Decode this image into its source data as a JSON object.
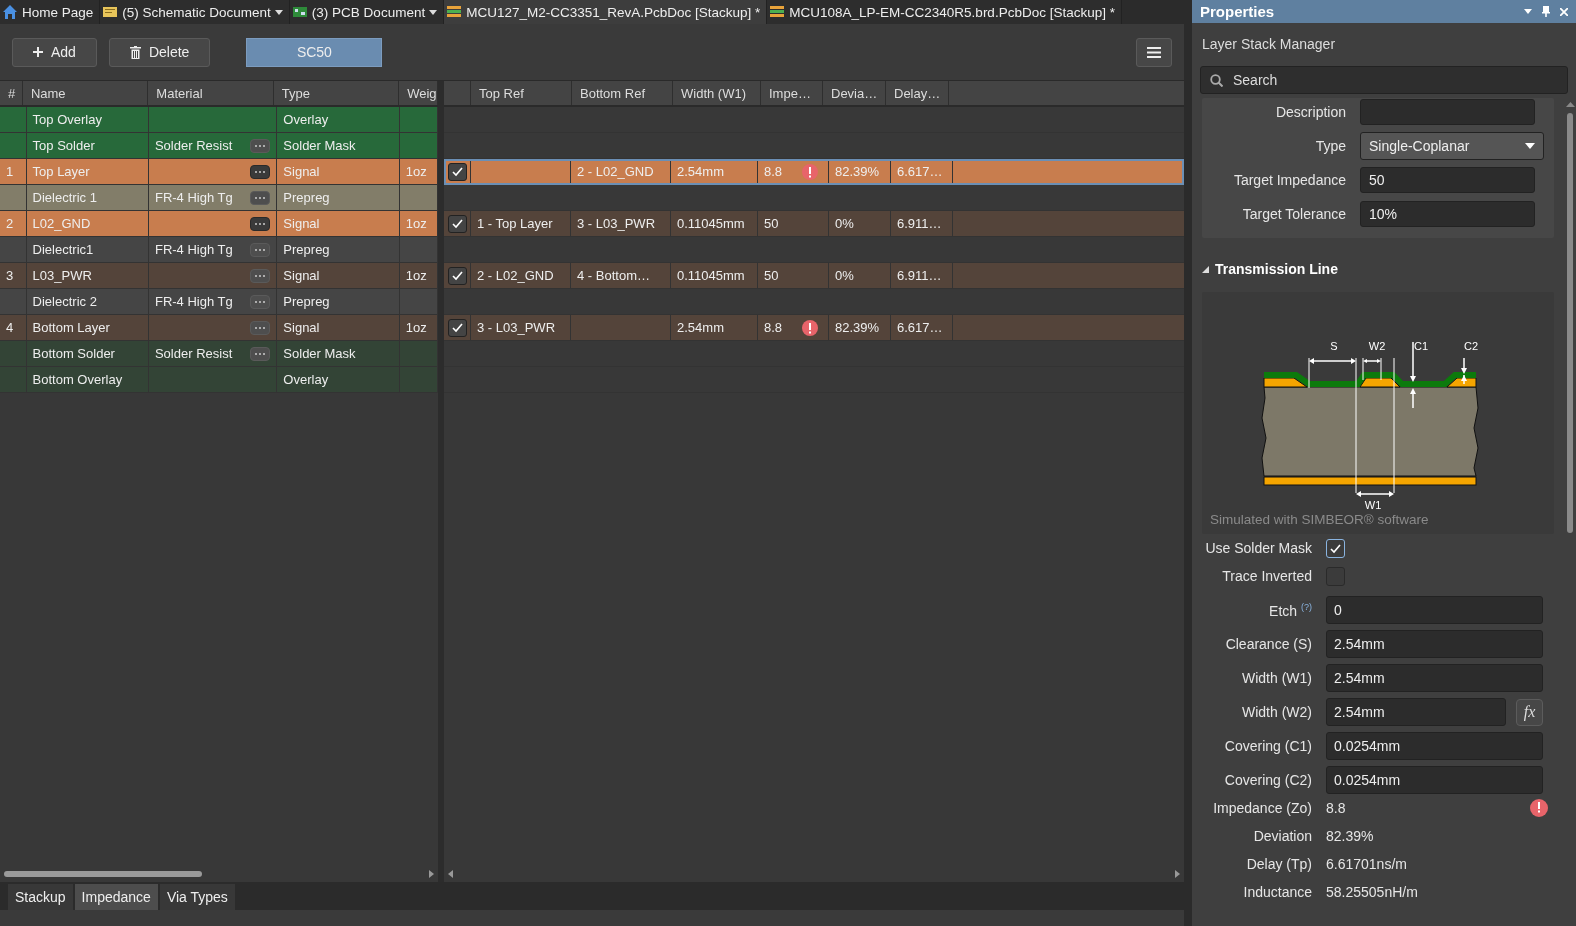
{
  "doc_tabs": [
    {
      "label": "Home Page",
      "kind": "home",
      "selected": false,
      "has_menu": false
    },
    {
      "label": "(5) Schematic Document",
      "kind": "schematic",
      "selected": false,
      "has_menu": true
    },
    {
      "label": "(3) PCB Document",
      "kind": "pcb",
      "selected": false,
      "has_menu": true
    },
    {
      "label": "MCU127_M2-CC3351_RevA.PcbDoc [Stackup] *",
      "kind": "stackup",
      "selected": true,
      "has_menu": false
    },
    {
      "label": "MCU108A_LP-EM-CC2340R5.brd.PcbDoc [Stackup] *",
      "kind": "stackup",
      "selected": false,
      "has_menu": false
    }
  ],
  "toolbar": {
    "buttons": [
      {
        "label": "Add",
        "kind": "add"
      },
      {
        "label": "Delete",
        "kind": "delete"
      }
    ],
    "profiles": [
      {
        "label": "SC50",
        "selected": true
      }
    ]
  },
  "layers": {
    "columns": [
      "#",
      "Name",
      "Material",
      "Type",
      "Weig"
    ],
    "rows": [
      {
        "name": "Top Overlay",
        "type": "Overlay",
        "color": "#27693a",
        "material_button": false
      },
      {
        "name": "Top Solder",
        "material": "Solder Resist",
        "type": "Solder Mask",
        "color": "#27693a",
        "material_button": true
      },
      {
        "number": "1",
        "name": "Top Layer",
        "type": "Signal",
        "weight": "1oz",
        "color": "#c87d4e",
        "material_button": true
      },
      {
        "name": "Dielectric 1",
        "material": "FR-4 High Tg",
        "type": "Prepreg",
        "color": "#827d69",
        "material_button": true
      },
      {
        "number": "2",
        "name": "L02_GND",
        "type": "Signal",
        "weight": "1oz",
        "color": "#c87d4e",
        "material_button": true
      },
      {
        "name": "Dielectric1",
        "material": "FR-4 High Tg",
        "type": "Prepreg",
        "color": "#454545",
        "material_button": true
      },
      {
        "number": "3",
        "name": "L03_PWR",
        "type": "Signal",
        "weight": "1oz",
        "color": "#54443a",
        "material_button": true
      },
      {
        "name": "Dielectric 2",
        "material": "FR-4 High Tg",
        "type": "Prepreg",
        "color": "#454545",
        "material_button": true
      },
      {
        "number": "4",
        "name": "Bottom Layer",
        "type": "Signal",
        "weight": "1oz",
        "color": "#54443a",
        "material_button": true
      },
      {
        "name": "Bottom Solder",
        "material": "Solder Resist",
        "type": "Solder Mask",
        "color": "#334436",
        "material_button": true
      },
      {
        "name": "Bottom Overlay",
        "type": "Overlay",
        "color": "#334436",
        "material_button": false
      }
    ]
  },
  "impedance": {
    "columns": [
      "Top Ref",
      "Bottom Ref",
      "Width (W1)",
      "Impe…",
      "Devia…",
      "Delay…"
    ],
    "rows": [
      {
        "checked": true,
        "selected": true,
        "bottom_ref": "2 - L02_GND",
        "width": "2.54mm",
        "impedance": "8.8",
        "warning": true,
        "deviation": "82.39%",
        "delay": "6.617…"
      },
      {
        "checked": true,
        "selected": false,
        "top_ref": "1 - Top Layer",
        "bottom_ref": "3 - L03_PWR",
        "width": "0.11045mm",
        "impedance": "50",
        "warning": false,
        "deviation": "0%",
        "delay": "6.911…"
      },
      {
        "checked": true,
        "selected": false,
        "top_ref": "2 - L02_GND",
        "bottom_ref": "4 - Bottom…",
        "width": "0.11045mm",
        "impedance": "50",
        "warning": false,
        "deviation": "0%",
        "delay": "6.911…"
      },
      {
        "checked": true,
        "selected": false,
        "top_ref": "3 - L03_PWR",
        "width": "2.54mm",
        "impedance": "8.8",
        "warning": true,
        "deviation": "82.39%",
        "delay": "6.617…"
      }
    ]
  },
  "bottom_tabs": [
    {
      "label": "Stackup",
      "selected": false
    },
    {
      "label": "Impedance",
      "selected": true
    },
    {
      "label": "Via Types",
      "selected": false
    }
  ],
  "panel": {
    "title": "Properties",
    "subtitle": "Layer Stack Manager",
    "search_placeholder": "Search",
    "profile_fields": [
      {
        "label": "Description",
        "kind": "text"
      },
      {
        "label": "Type",
        "kind": "dropdown",
        "value": "Single-Coplanar"
      },
      {
        "label": "Target Impedance",
        "kind": "text",
        "value": "50"
      },
      {
        "label": "Target Tolerance",
        "kind": "text",
        "value": "10%"
      }
    ],
    "section": {
      "title": "Transmission Line",
      "expanded": true,
      "caption": "Simulated with SIMBEOR® software",
      "labels": [
        "S",
        "W2",
        "C1",
        "C2",
        "W1"
      ]
    },
    "options": [
      {
        "label": "Use Solder Mask",
        "kind": "checkbox",
        "checked": true
      },
      {
        "label": "Trace Inverted",
        "kind": "checkbox",
        "checked": false
      },
      {
        "label": "Etch",
        "help": "(?)",
        "kind": "field",
        "value": "0"
      },
      {
        "label": "Clearance (S)",
        "kind": "field",
        "value": "2.54mm"
      },
      {
        "label": "Width (W1)",
        "kind": "field",
        "value": "2.54mm"
      },
      {
        "label": "Width (W2)",
        "kind": "field",
        "value": "2.54mm",
        "formula_button": "fx"
      },
      {
        "label": "Covering (C1)",
        "kind": "field",
        "value": "0.0254mm"
      },
      {
        "label": "Covering (C2)",
        "kind": "field",
        "value": "0.0254mm"
      },
      {
        "label": "Impedance (Zo)",
        "kind": "reading",
        "value": "8.8",
        "warning": true
      },
      {
        "label": "Deviation",
        "kind": "reading",
        "value": "82.39%",
        "warning": false
      },
      {
        "label": "Delay (Tp)",
        "kind": "reading",
        "value": "6.61701ns/m",
        "warning": false
      },
      {
        "label": "Inductance",
        "kind": "reading",
        "value": "58.25505nH/m",
        "warning": false
      }
    ]
  }
}
